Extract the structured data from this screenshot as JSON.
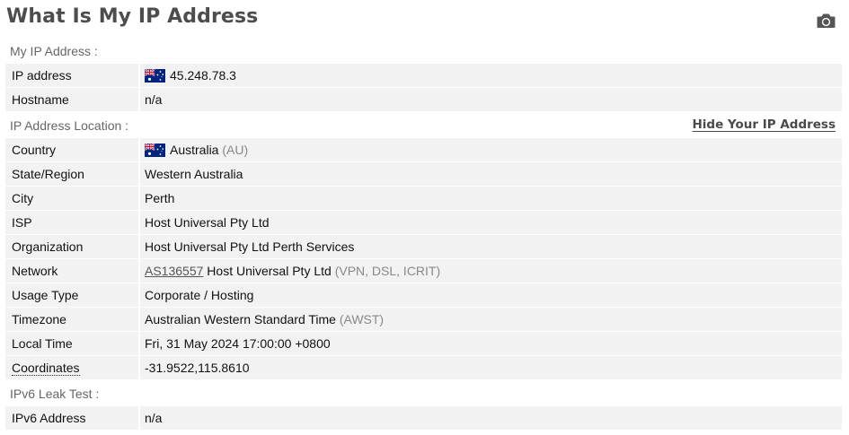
{
  "page": {
    "title": "What Is My IP Address",
    "camera_icon": "camera-icon"
  },
  "sections": {
    "my_ip": "My IP Address :",
    "location": "IP Address Location :",
    "ipv6": "IPv6 Leak Test :"
  },
  "hide_link": "Hide Your IP Address",
  "rows": {
    "ip_address": {
      "label": "IP address",
      "value": "45.248.78.3",
      "flag": "australia-flag-icon"
    },
    "hostname": {
      "label": "Hostname",
      "value": "n/a"
    },
    "country": {
      "label": "Country",
      "value": "Australia",
      "extra": "(AU)",
      "flag": "australia-flag-icon"
    },
    "state": {
      "label": "State/Region",
      "value": "Western Australia"
    },
    "city": {
      "label": "City",
      "value": "Perth"
    },
    "isp": {
      "label": "ISP",
      "value": "Host Universal Pty Ltd"
    },
    "organization": {
      "label": "Organization",
      "value": "Host Universal Pty Ltd Perth Services"
    },
    "network": {
      "label": "Network",
      "asn": "AS136557",
      "value": "Host Universal Pty Ltd",
      "extra": "(VPN, DSL, ICRIT)"
    },
    "usage_type": {
      "label": "Usage Type",
      "value": "Corporate / Hosting"
    },
    "timezone": {
      "label": "Timezone",
      "value": "Australian Western Standard Time",
      "extra": "(AWST)"
    },
    "local_time": {
      "label": "Local Time",
      "value": "Fri, 31 May 2024 17:00:00 +0800"
    },
    "coordinates": {
      "label": "Coordinates",
      "value": "-31.9522,115.8610"
    },
    "ipv6_address": {
      "label": "IPv6 Address",
      "value": "n/a"
    }
  },
  "colors": {
    "row_bg": "#f2f2f2",
    "title": "#4d4d4d",
    "muted": "#888888",
    "flag_blue": "#00247d",
    "flag_red": "#cf142b"
  }
}
